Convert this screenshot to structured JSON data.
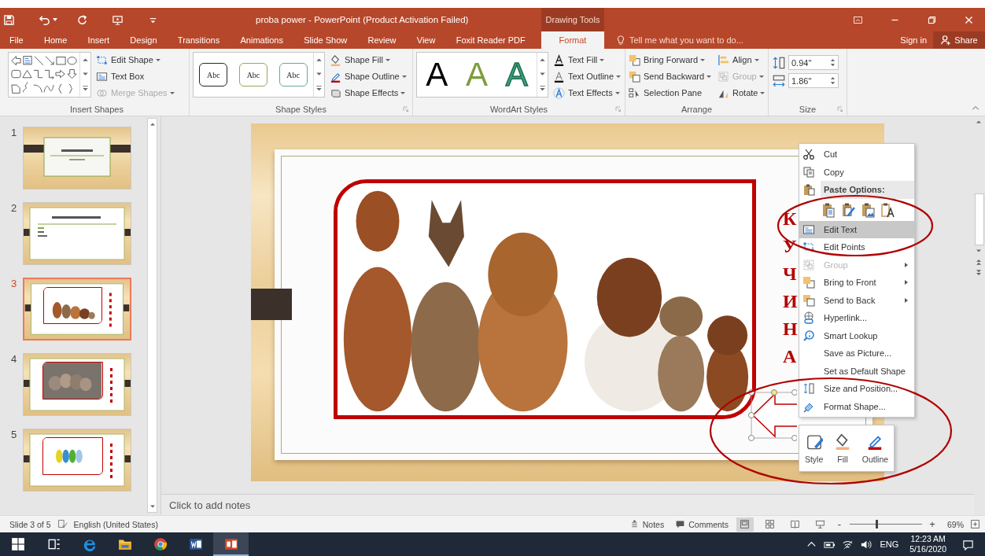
{
  "title_bar": {
    "title": "proba power - PowerPoint (Product Activation Failed)",
    "context_label": "Drawing Tools"
  },
  "tabs": [
    {
      "label": "File",
      "selected": false
    },
    {
      "label": "Home",
      "selected": false
    },
    {
      "label": "Insert",
      "selected": false
    },
    {
      "label": "Design",
      "selected": false
    },
    {
      "label": "Transitions",
      "selected": false
    },
    {
      "label": "Animations",
      "selected": false
    },
    {
      "label": "Slide Show",
      "selected": false
    },
    {
      "label": "Review",
      "selected": false
    },
    {
      "label": "View",
      "selected": false
    },
    {
      "label": "Foxit Reader PDF",
      "selected": false
    },
    {
      "label": "Format",
      "selected": true
    }
  ],
  "tell_me": {
    "placeholder": "Tell me what you want to do..."
  },
  "account": {
    "sign_in": "Sign in",
    "share": "Share"
  },
  "ribbon": {
    "insert_shapes": {
      "label": "Insert Shapes",
      "commands": [
        {
          "label": "Edit Shape",
          "menu": true,
          "disabled": false
        },
        {
          "label": "Text Box",
          "menu": false,
          "disabled": false
        },
        {
          "label": "Merge Shapes",
          "menu": true,
          "disabled": true
        }
      ]
    },
    "shape_styles": {
      "label": "Shape Styles",
      "presets": [
        {
          "label": "Abc",
          "color": "#262626"
        },
        {
          "label": "Abc",
          "color": "#93a95a"
        },
        {
          "label": "Abc",
          "color": "#6aa6a0"
        }
      ],
      "commands": [
        {
          "label": "Shape Fill",
          "menu": true,
          "disabled": false
        },
        {
          "label": "Shape Outline",
          "menu": true,
          "disabled": false
        },
        {
          "label": "Shape Effects",
          "menu": true,
          "disabled": false
        }
      ]
    },
    "wordart_styles": {
      "label": "WordArt Styles",
      "presets": [
        {
          "label": "A",
          "kind": "solid",
          "color": "#000000"
        },
        {
          "label": "A",
          "kind": "solid",
          "color": "#7e9c3c"
        },
        {
          "label": "A",
          "kind": "outline",
          "color": "#3aa37c"
        }
      ],
      "commands": [
        {
          "label": "Text Fill",
          "menu": true,
          "disabled": false
        },
        {
          "label": "Text Outline",
          "menu": true,
          "disabled": false
        },
        {
          "label": "Text Effects",
          "menu": true,
          "disabled": false
        }
      ]
    },
    "arrange": {
      "label": "Arrange",
      "commands": [
        {
          "label": "Bring Forward",
          "menu": true,
          "disabled": false
        },
        {
          "label": "Send Backward",
          "menu": true,
          "disabled": false
        },
        {
          "label": "Selection Pane",
          "menu": false,
          "disabled": false
        },
        {
          "label": "Align",
          "menu": true,
          "disabled": false
        },
        {
          "label": "Group",
          "menu": true,
          "disabled": true
        },
        {
          "label": "Rotate",
          "menu": true,
          "disabled": false
        }
      ]
    },
    "size": {
      "label": "Size",
      "fields": [
        {
          "value": "0.94\""
        },
        {
          "value": "1.86\""
        }
      ]
    }
  },
  "slides": [
    {
      "number": "1",
      "kind": "title",
      "selected": false
    },
    {
      "number": "2",
      "kind": "bullets",
      "selected": false
    },
    {
      "number": "3",
      "selected": true
    },
    {
      "number": "4",
      "selected": false
    },
    {
      "number": "5",
      "selected": false
    }
  ],
  "slide": {
    "side_text": "КУЧИНА"
  },
  "notes": {
    "placeholder": "Click to add notes"
  },
  "context_menu": {
    "items": [
      {
        "kind": "command",
        "label": "Cut",
        "disabled": false,
        "highlighted": false,
        "submenu": false
      },
      {
        "kind": "command",
        "label": "Copy",
        "disabled": false,
        "highlighted": false,
        "submenu": false
      },
      {
        "kind": "header",
        "label": "Paste Options:"
      },
      {
        "kind": "paste_options"
      },
      {
        "kind": "command",
        "label": "Edit Text",
        "disabled": false,
        "highlighted": true,
        "submenu": false
      },
      {
        "kind": "command",
        "label": "Edit Points",
        "disabled": false,
        "highlighted": false,
        "submenu": false
      },
      {
        "kind": "command",
        "label": "Group",
        "disabled": true,
        "highlighted": false,
        "submenu": true
      },
      {
        "kind": "command",
        "label": "Bring to Front",
        "disabled": false,
        "highlighted": false,
        "submenu": true
      },
      {
        "kind": "command",
        "label": "Send to Back",
        "disabled": false,
        "highlighted": false,
        "submenu": true
      },
      {
        "kind": "command",
        "label": "Hyperlink...",
        "disabled": false,
        "highlighted": false,
        "submenu": false
      },
      {
        "kind": "command",
        "label": "Smart Lookup",
        "disabled": false,
        "highlighted": false,
        "submenu": false
      },
      {
        "kind": "command",
        "label": "Save as Picture...",
        "disabled": false,
        "highlighted": false,
        "submenu": false
      },
      {
        "kind": "command",
        "label": "Set as Default Shape",
        "disabled": false,
        "highlighted": false,
        "submenu": false
      },
      {
        "kind": "command",
        "label": "Size and Position...",
        "disabled": false,
        "highlighted": false,
        "submenu": false
      },
      {
        "kind": "command",
        "label": "Format Shape...",
        "disabled": false,
        "highlighted": false,
        "submenu": false
      }
    ]
  },
  "mini_toolbar": {
    "buttons": [
      {
        "label": "Style"
      },
      {
        "label": "Fill"
      },
      {
        "label": "Outline"
      }
    ]
  },
  "status_bar": {
    "slide_info": "Slide 3 of 5",
    "language": "English (United States)",
    "notes": "Notes",
    "comments": "Comments",
    "views": [
      {
        "selected": true
      },
      {
        "selected": false
      },
      {
        "selected": false
      },
      {
        "selected": false
      }
    ],
    "zoom_out": "-",
    "zoom_in": "+",
    "zoom": {
      "level": 0.37,
      "percent": "69%"
    }
  },
  "taskbar": {
    "apps": [
      {
        "selected": false
      },
      {
        "selected": false
      },
      {
        "selected": false
      },
      {
        "selected": false
      },
      {
        "selected": false
      },
      {
        "selected": true
      }
    ],
    "tray": {
      "language": "ENG",
      "time": "12:23 AM",
      "date": "5/16/2020"
    }
  }
}
